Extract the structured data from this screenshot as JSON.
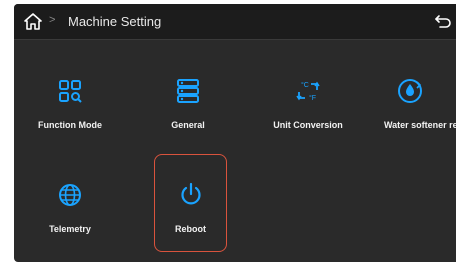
{
  "header": {
    "title": "Machine Setting",
    "separator": ">",
    "icons": {
      "home": "home-icon",
      "back": "back-arrow-icon"
    }
  },
  "tiles": [
    {
      "label": "Function Mode",
      "icon": "function-mode-icon"
    },
    {
      "label": "General",
      "icon": "general-list-icon"
    },
    {
      "label": "Unit Conversion",
      "icon": "unit-conversion-icon"
    },
    {
      "label": "Water softener res",
      "icon": "water-softener-icon"
    },
    {
      "label": "Telemetry",
      "icon": "globe-icon"
    },
    {
      "label": "Reboot",
      "icon": "power-icon",
      "selected": true
    }
  ],
  "colors": {
    "accent": "#1aa3ff",
    "selection": "#d9533d",
    "background": "#2a2a2a",
    "header": "#1c1c1c"
  }
}
